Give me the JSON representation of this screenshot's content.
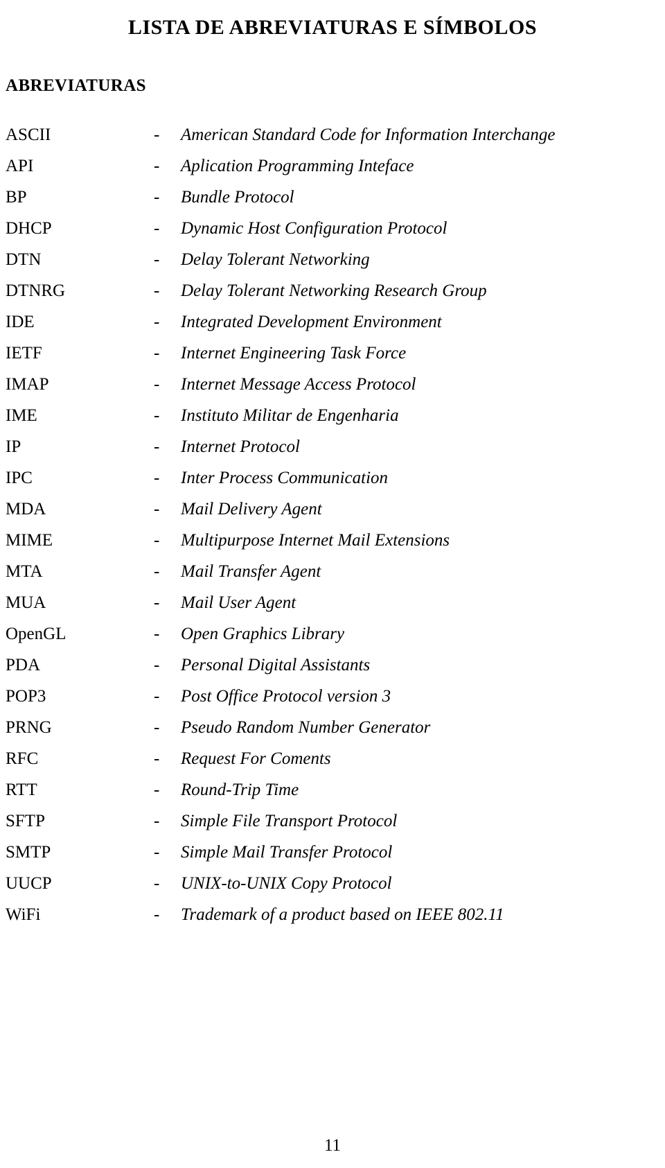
{
  "page": {
    "title": "LISTA DE ABREVIATURAS E SÍMBOLOS",
    "page_number": "11",
    "text_color": "#000000",
    "background_color": "#ffffff"
  },
  "section": {
    "heading": "ABREVIATURAS",
    "separator": "-"
  },
  "abbreviations": [
    {
      "term": "ASCII",
      "separator": "-",
      "definition": "American Standard Code for Information Interchange"
    },
    {
      "term": "API",
      "separator": "-",
      "definition": "Aplication Programming Inteface"
    },
    {
      "term": "BP",
      "separator": "-",
      "definition": "Bundle Protocol"
    },
    {
      "term": "DHCP",
      "separator": "-",
      "definition": "Dynamic Host Configuration Protocol"
    },
    {
      "term": "DTN",
      "separator": "-",
      "definition": "Delay Tolerant Networking"
    },
    {
      "term": "DTNRG",
      "separator": "-",
      "definition": "Delay Tolerant Networking Research Group"
    },
    {
      "term": "IDE",
      "separator": "-",
      "definition": "Integrated Development Environment"
    },
    {
      "term": "IETF",
      "separator": "-",
      "definition": "Internet Engineering Task Force"
    },
    {
      "term": "IMAP",
      "separator": "-",
      "definition": "Internet Message Access Protocol"
    },
    {
      "term": "IME",
      "separator": "-",
      "definition": "Instituto Militar de Engenharia"
    },
    {
      "term": "IP",
      "separator": "-",
      "definition": "Internet Protocol"
    },
    {
      "term": "IPC",
      "separator": "-",
      "definition": "Inter Process Communication"
    },
    {
      "term": "MDA",
      "separator": "-",
      "definition": "Mail Delivery Agent"
    },
    {
      "term": "MIME",
      "separator": "-",
      "definition": "Multipurpose Internet Mail Extensions"
    },
    {
      "term": "MTA",
      "separator": "-",
      "definition": "Mail Transfer Agent"
    },
    {
      "term": "MUA",
      "separator": "-",
      "definition": "Mail User Agent"
    },
    {
      "term": "OpenGL",
      "separator": "-",
      "definition": "Open Graphics Library"
    },
    {
      "term": "PDA",
      "separator": "-",
      "definition": "Personal Digital Assistants"
    },
    {
      "term": "POP3",
      "separator": "-",
      "definition": "Post Office Protocol version 3"
    },
    {
      "term": "PRNG",
      "separator": "-",
      "definition": "Pseudo Random Number Generator"
    },
    {
      "term": "RFC",
      "separator": "-",
      "definition": "Request For Coments"
    },
    {
      "term": "RTT",
      "separator": "-",
      "definition": "Round-Trip Time"
    },
    {
      "term": "SFTP",
      "separator": "-",
      "definition": "Simple File Transport Protocol"
    },
    {
      "term": "SMTP",
      "separator": "-",
      "definition": "Simple Mail Transfer Protocol"
    },
    {
      "term": "UUCP",
      "separator": "-",
      "definition": "UNIX-to-UNIX Copy Protocol"
    },
    {
      "term": "WiFi",
      "separator": "-",
      "definition": "Trademark of a product based on IEEE 802.11"
    }
  ]
}
